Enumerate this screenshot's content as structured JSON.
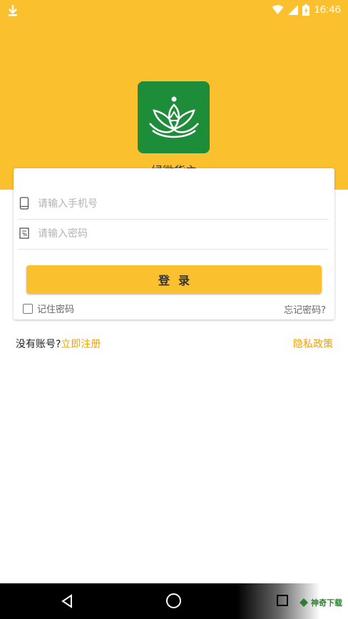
{
  "status_bar": {
    "time": "16:46"
  },
  "app": {
    "name": "绿微货主"
  },
  "login_form": {
    "phone_placeholder": "请输入手机号",
    "password_placeholder": "请输入密码",
    "login_label": "登录",
    "remember_label": "记住密码",
    "forgot_label": "忘记密码?"
  },
  "links": {
    "no_account_text": "没有账号?",
    "register_label": "立即注册",
    "privacy_label": "隐私政策"
  },
  "watermark": {
    "text": "神奇下载"
  },
  "colors": {
    "brand_yellow": "#fbc02d",
    "logo_green": "#1e8d3a",
    "link_orange": "#f0a000"
  }
}
